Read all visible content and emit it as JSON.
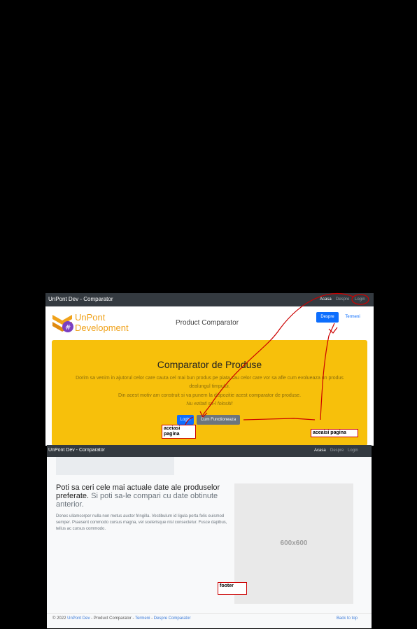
{
  "top_screenshot": {
    "navbar": {
      "brand": "UnPont Dev - Comparator",
      "links": [
        "Acasa",
        "Despre",
        "Login"
      ]
    },
    "header": {
      "logo_line1": "UnPont",
      "logo_line2": "Development",
      "product_title": "Product Comparator",
      "btn_despre": "Despre",
      "btn_termeni": "Termeni"
    },
    "hero": {
      "title": "Comparator de Produse",
      "text1": "Dorim sa venim in ajutorul celor care cauta cel mai bun produs pe piata sau celor care vor sa afle cum evolueaza un produs dealungul timpului.",
      "text2": "Din acest motiv am construit si va punem la dispozitie acest comparator de produse.",
      "text3": "Nu ezitati sa-l folositi!",
      "btn_login": "Login",
      "btn_cum": "Cum Functioneaza"
    },
    "annotations": {
      "label1": "aceiasi pagina",
      "label2": "aceaisi pagina"
    }
  },
  "bottom_screenshot": {
    "navbar": {
      "brand": "UnPont Dev - Comparator",
      "links": [
        "Acasa",
        "Despre",
        "Login"
      ]
    },
    "feature": {
      "heading": "Poti sa ceri cele mai actuale date ale produselor preferate.",
      "heading_muted": "Si poti sa-le compari cu date obtinute anterior.",
      "paragraph": "Donec ullamcorper nulla non metus auctor fringilla. Vestibulum id ligula porta felis euismod semper. Praesent commodo cursus magna, vel scelerisque nisl consectetur. Fusce dapibus, tellus ac cursus commodo."
    },
    "placeholder_label": "600x600",
    "footer": {
      "copyright": "© 2022",
      "brand_link": "UnPont Dev",
      "dash1": "- Product Comparator -",
      "termeni": "Termeni",
      "dash2": "-",
      "despre": "Despre Comparator",
      "back_to_top": "Back to top"
    },
    "annotation_footer": "footer"
  },
  "colors": {
    "navbar": "#343a40",
    "hero": "#f7c00b",
    "primary": "#0d6efd",
    "secondary": "#6c757d",
    "annotation": "#cc0000"
  }
}
